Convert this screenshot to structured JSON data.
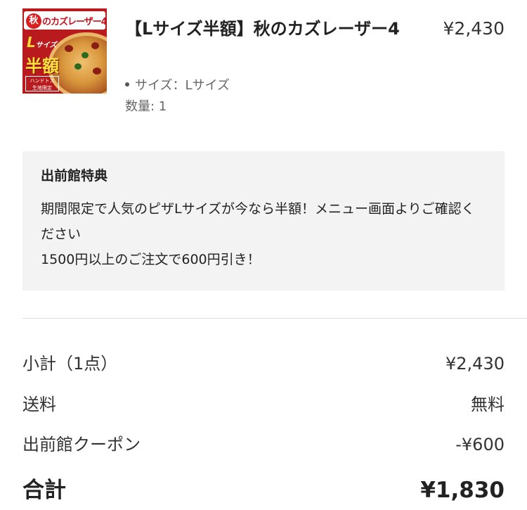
{
  "item": {
    "thumbnail": {
      "icon": "pizza-product-image",
      "aki_char": "秋",
      "banner_text": "のカズレーザー4",
      "size_text": "L",
      "size_small": "サイズ",
      "hangaku": "半額",
      "badge": "ハンドトス\n生地限定"
    },
    "title": "【Lサイズ半額】秋のカズレーザー4",
    "price": "¥2,430",
    "option": "サイズ：Lサイズ",
    "quantity": "数量: 1"
  },
  "perk": {
    "title": "出前館特典",
    "line1": "期間限定で人気のピザLサイズが今なら半額！メニュー画面よりご確認ください",
    "line2": "1500円以上のご注文で600円引き！"
  },
  "summary": {
    "subtotal_label": "小計（1点）",
    "subtotal_value": "¥2,430",
    "shipping_label": "送料",
    "shipping_value": "無料",
    "coupon_label": "出前館クーポン",
    "coupon_value": "-¥600",
    "total_label": "合計",
    "total_value": "¥1,830"
  },
  "colors": {
    "perk_background": "#f3f3f3",
    "thumbnail_red": "#b81a1d",
    "text": "#222222",
    "muted_text": "#666666"
  }
}
